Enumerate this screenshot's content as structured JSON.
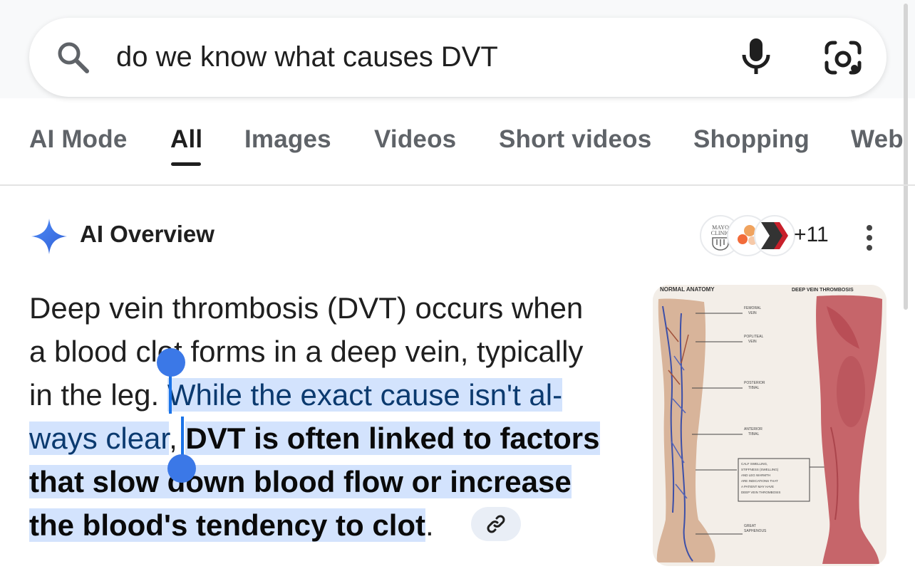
{
  "search": {
    "query": "do we know what causes DVT",
    "icons": [
      "search-icon",
      "mic-icon",
      "lens-icon"
    ]
  },
  "tabs": [
    {
      "label": "AI Mode",
      "active": false
    },
    {
      "label": "All",
      "active": true
    },
    {
      "label": "Images",
      "active": false
    },
    {
      "label": "Videos",
      "active": false
    },
    {
      "label": "Short videos",
      "active": false
    },
    {
      "label": "Shopping",
      "active": false
    },
    {
      "label": "Web",
      "active": false
    }
  ],
  "overview": {
    "title": "AI Overview",
    "more_sources": "+11",
    "line1": "Deep vein thrombosis (DVT) occurs when",
    "line2": "a blood clot forms in a deep vein, typically",
    "line3_plain": "in the leg.",
    "line3_highlight": "While the exact cause isn't al-",
    "line4_highlight": "ways clear",
    "line4_comma": ",",
    "line4_bold": "DVT is often linked to factors",
    "line5_bold": "that slow down blood flow or increase",
    "line6_bold": "the blood's tendency to clot",
    "line6_period": ".",
    "image_labels": {
      "left_header": "NORMAL ANATOMY",
      "right_header": "DEEP VEIN THROMBOSIS",
      "mayo": "MAYO CLINIC"
    }
  },
  "colors": {
    "accent": "#1a73e8",
    "highlight": "#d3e3fd",
    "sparkle": "#4285f4"
  }
}
